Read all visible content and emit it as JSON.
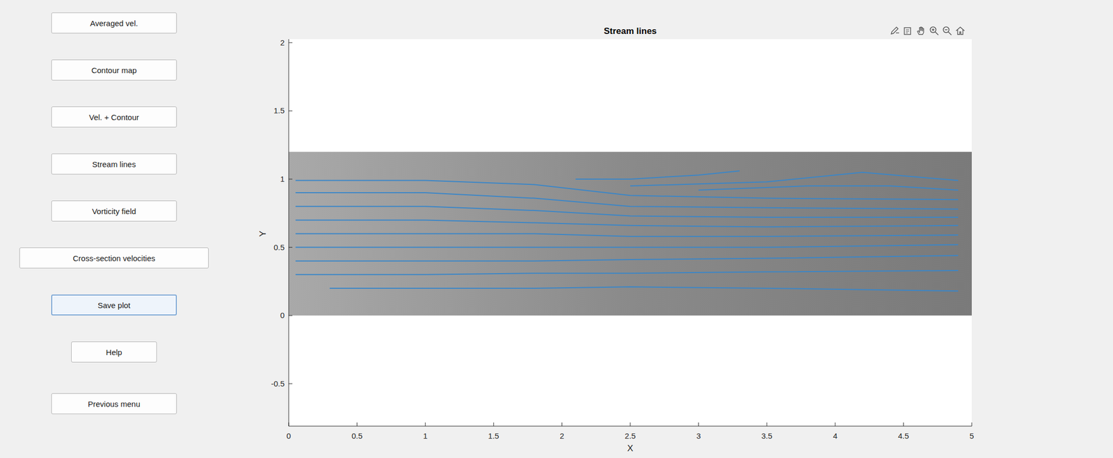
{
  "buttons": [
    {
      "label": "Averaged vel.",
      "focused": false
    },
    {
      "label": "Contour map",
      "focused": false
    },
    {
      "label": "Vel. + Contour",
      "focused": false
    },
    {
      "label": "Stream lines",
      "focused": false
    },
    {
      "label": "Vorticity field",
      "focused": false
    },
    {
      "label": "Cross-section velocities",
      "focused": false
    },
    {
      "label": "Save plot",
      "focused": true
    },
    {
      "label": "Help",
      "focused": false
    },
    {
      "label": "Previous menu",
      "focused": false
    }
  ],
  "plot": {
    "title": "Stream lines",
    "xLabel": "X",
    "yLabel": "Y",
    "xTicks": [
      "0",
      "0.5",
      "1",
      "1.5",
      "2",
      "2.5",
      "3",
      "3.5",
      "4",
      "4.5",
      "5"
    ],
    "yTicks": [
      "-0.5",
      "0",
      "0.5",
      "1",
      "1.5",
      "2"
    ],
    "image": {
      "x": [
        0,
        5
      ],
      "y": [
        0,
        1.2
      ]
    },
    "streamlines": [
      {
        "x": [
          0.05,
          1,
          1.8,
          2.5,
          3.5,
          4.9
        ],
        "y": [
          0.99,
          0.99,
          0.96,
          0.88,
          0.86,
          0.85
        ]
      },
      {
        "x": [
          0.05,
          1,
          1.8,
          2.5,
          3.5,
          4.9
        ],
        "y": [
          0.9,
          0.9,
          0.86,
          0.8,
          0.79,
          0.78
        ]
      },
      {
        "x": [
          0.05,
          1,
          1.8,
          2.5,
          3.5,
          4.9
        ],
        "y": [
          0.8,
          0.8,
          0.77,
          0.73,
          0.72,
          0.72
        ]
      },
      {
        "x": [
          0.05,
          1,
          1.8,
          2.5,
          3.5,
          4.9
        ],
        "y": [
          0.7,
          0.7,
          0.68,
          0.66,
          0.65,
          0.66
        ]
      },
      {
        "x": [
          0.05,
          1,
          1.8,
          2.5,
          3.5,
          4.9
        ],
        "y": [
          0.6,
          0.6,
          0.6,
          0.58,
          0.58,
          0.59
        ]
      },
      {
        "x": [
          0.05,
          1,
          1.8,
          2.5,
          3.5,
          4.9
        ],
        "y": [
          0.5,
          0.5,
          0.5,
          0.5,
          0.5,
          0.52
        ]
      },
      {
        "x": [
          0.05,
          1,
          1.8,
          2.5,
          3.5,
          4.9
        ],
        "y": [
          0.4,
          0.4,
          0.4,
          0.41,
          0.42,
          0.44
        ]
      },
      {
        "x": [
          0.05,
          1,
          1.8,
          2.5,
          3.5,
          4.9
        ],
        "y": [
          0.3,
          0.3,
          0.31,
          0.31,
          0.32,
          0.33
        ]
      },
      {
        "x": [
          0.3,
          1,
          1.8,
          2.5,
          3.5,
          4.9
        ],
        "y": [
          0.2,
          0.2,
          0.2,
          0.21,
          0.2,
          0.18
        ]
      },
      {
        "x": [
          2.1,
          2.5,
          3,
          3.3
        ],
        "y": [
          1.0,
          1.0,
          1.03,
          1.06
        ]
      },
      {
        "x": [
          2.5,
          3.5,
          4.2,
          4.9
        ],
        "y": [
          0.95,
          0.98,
          1.05,
          0.99
        ]
      },
      {
        "x": [
          3,
          3.8,
          4.4,
          4.9
        ],
        "y": [
          0.92,
          0.95,
          0.95,
          0.92
        ]
      }
    ]
  }
}
